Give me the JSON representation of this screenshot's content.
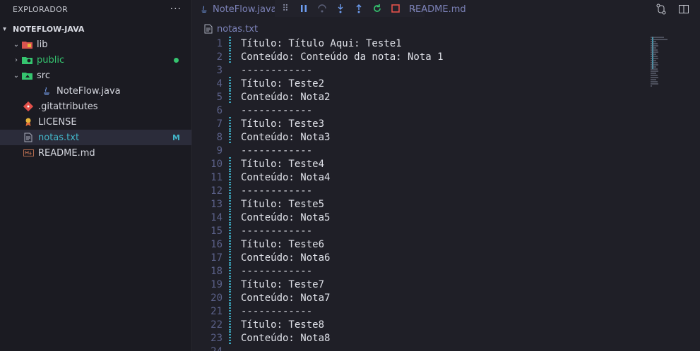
{
  "sidebar": {
    "title": "EXPLORADOR",
    "more": "···",
    "project": "NOTEFLOW-JAVA",
    "items": [
      {
        "label": "lib",
        "type": "folder",
        "expanded": true
      },
      {
        "label": "public",
        "type": "folder",
        "expanded": false,
        "status": "modified-dot"
      },
      {
        "label": "src",
        "type": "folder",
        "expanded": true
      },
      {
        "label": "NoteFlow.java",
        "type": "java-file"
      },
      {
        "label": ".gitattributes",
        "type": "git-file"
      },
      {
        "label": "LICENSE",
        "type": "license-file"
      },
      {
        "label": "notas.txt",
        "type": "text-file",
        "badge": "M",
        "selected": true
      },
      {
        "label": "README.md",
        "type": "markdown-file"
      }
    ]
  },
  "tabs": [
    {
      "label": "NoteFlow.java"
    },
    {
      "label": "README.md"
    }
  ],
  "breadcrumb": {
    "file": "notas.txt"
  },
  "editor": {
    "lines": [
      {
        "n": "1",
        "text": "Título: Título Aqui: Teste1",
        "mod": true
      },
      {
        "n": "2",
        "text": "Conteúdo: Conteúdo da nota: Nota 1",
        "mod": true
      },
      {
        "n": "3",
        "text": "------------",
        "mod": false
      },
      {
        "n": "4",
        "text": "Título: Teste2",
        "mod": true
      },
      {
        "n": "5",
        "text": "Conteúdo: Nota2",
        "mod": true
      },
      {
        "n": "6",
        "text": "------------",
        "mod": false
      },
      {
        "n": "7",
        "text": "Título: Teste3",
        "mod": true
      },
      {
        "n": "8",
        "text": "Conteúdo: Nota3",
        "mod": true
      },
      {
        "n": "9",
        "text": "------------",
        "mod": false
      },
      {
        "n": "10",
        "text": "Título: Teste4",
        "mod": true
      },
      {
        "n": "11",
        "text": "Conteúdo: Nota4",
        "mod": true
      },
      {
        "n": "12",
        "text": "------------",
        "mod": true
      },
      {
        "n": "13",
        "text": "Título: Teste5",
        "mod": true
      },
      {
        "n": "14",
        "text": "Conteúdo: Nota5",
        "mod": true
      },
      {
        "n": "15",
        "text": "------------",
        "mod": true
      },
      {
        "n": "16",
        "text": "Título: Teste6",
        "mod": true
      },
      {
        "n": "17",
        "text": "Conteúdo: Nota6",
        "mod": true
      },
      {
        "n": "18",
        "text": "------------",
        "mod": true
      },
      {
        "n": "19",
        "text": "Título: Teste7",
        "mod": true
      },
      {
        "n": "20",
        "text": "Conteúdo: Nota7",
        "mod": true
      },
      {
        "n": "21",
        "text": "------------",
        "mod": true
      },
      {
        "n": "22",
        "text": "Título: Teste8",
        "mod": true
      },
      {
        "n": "23",
        "text": "Conteúdo: Nota8",
        "mod": true
      },
      {
        "n": "24",
        "text": "",
        "mod": false
      }
    ]
  },
  "colors": {
    "accent": "#43b6c9",
    "modified": "#35c46f",
    "line_numbers": "#5b6189"
  }
}
